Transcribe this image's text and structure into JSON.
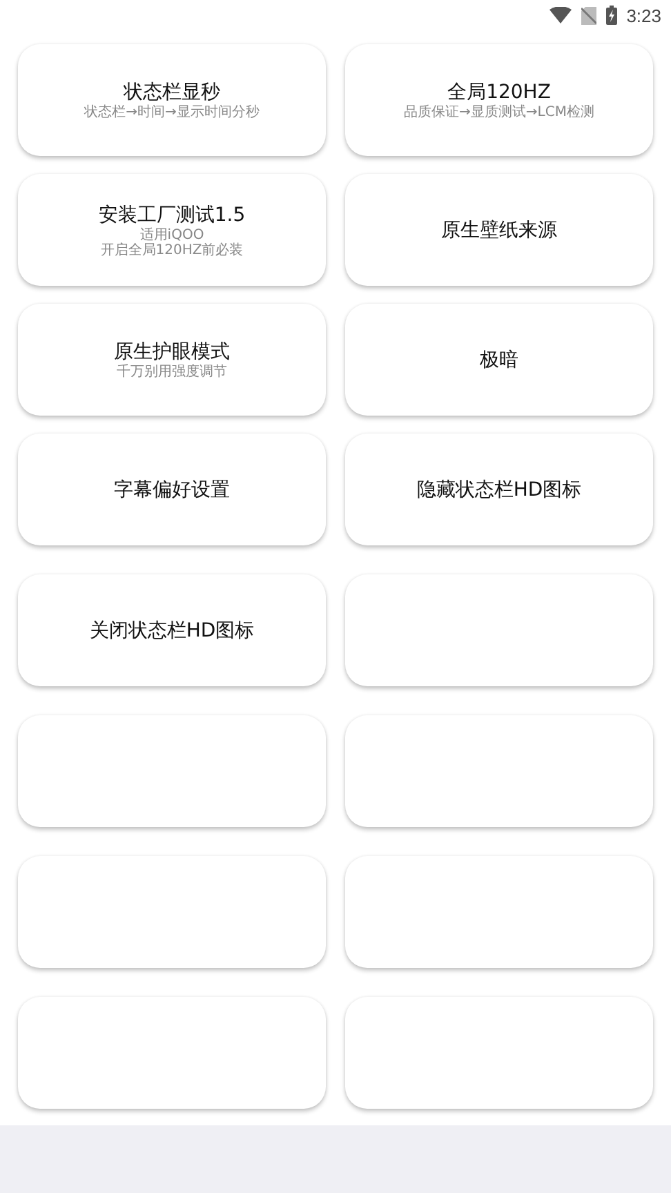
{
  "status_bar": {
    "time": "3:23"
  },
  "cards": [
    {
      "kind": "label",
      "title": "状态栏显秒",
      "subtitle": [
        "状态栏→时间→显示时间分秒"
      ]
    },
    {
      "kind": "label",
      "title": "全局120HZ",
      "subtitle": [
        "品质保证→显质测试→LCM检测"
      ]
    },
    {
      "kind": "label",
      "title": "安装工厂测试1.5",
      "subtitle": [
        "适用iQOO",
        "开启全局120HZ前必装"
      ]
    },
    {
      "kind": "label",
      "title": "原生壁纸来源"
    },
    {
      "kind": "label",
      "title": "原生护眼模式",
      "subtitle": [
        "千万别用强度调节"
      ]
    },
    {
      "kind": "label",
      "title": "极暗"
    },
    {
      "kind": "label",
      "title": "字幕偏好设置"
    },
    {
      "kind": "label",
      "title": "隐藏状态栏HD图标"
    }
  ],
  "more_cards": [
    {
      "kind": "label",
      "title": "关闭状态栏HD图标"
    },
    {
      "kind": "blank"
    },
    {
      "kind": "blank"
    },
    {
      "kind": "blank"
    },
    {
      "kind": "blank"
    },
    {
      "kind": "blank"
    },
    {
      "kind": "blank"
    },
    {
      "kind": "blank"
    }
  ]
}
